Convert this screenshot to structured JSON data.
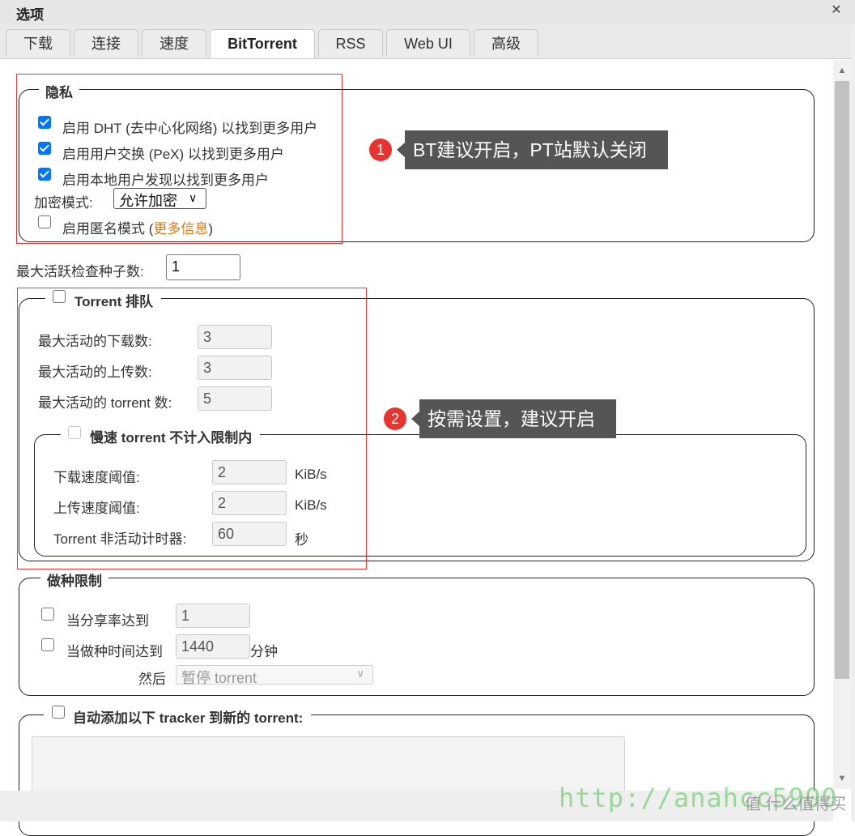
{
  "dialog": {
    "title": "选项",
    "close": "✕"
  },
  "tabs": [
    {
      "label": "下载"
    },
    {
      "label": "连接"
    },
    {
      "label": "速度"
    },
    {
      "label": "BitTorrent"
    },
    {
      "label": "RSS"
    },
    {
      "label": "Web UI"
    },
    {
      "label": "高级"
    }
  ],
  "privacy": {
    "legend": "隐私",
    "dht": "启用 DHT (去中心化网络) 以找到更多用户",
    "pex": "启用用户交换 (PeX) 以找到更多用户",
    "lsd": "启用本地用户发现以找到更多用户",
    "encryption_label": "加密模式:",
    "encryption_value": "允许加密",
    "anon_label": "启用匿名模式 (",
    "anon_link": "更多信息",
    "anon_close": ")"
  },
  "max_checking": {
    "label": "最大活跃检查种子数:",
    "value": "1"
  },
  "queue": {
    "legend": "Torrent 排队",
    "downloads_label": "最大活动的下载数:",
    "downloads_value": "3",
    "uploads_label": "最大活动的上传数:",
    "uploads_value": "3",
    "torrents_label": "最大活动的 torrent 数:",
    "torrents_value": "5",
    "slow": {
      "legend": "慢速 torrent 不计入限制内",
      "dl_label": "下载速度阈值:",
      "dl_value": "2",
      "dl_unit": "KiB/s",
      "ul_label": "上传速度阈值:",
      "ul_value": "2",
      "ul_unit": "KiB/s",
      "timer_label": "Torrent 非活动计时器:",
      "timer_value": "60",
      "timer_unit": "秒"
    }
  },
  "seeding": {
    "legend": "做种限制",
    "ratio_label": "当分享率达到",
    "ratio_value": "1",
    "time_label": "当做种时间达到",
    "time_value": "1440",
    "time_unit": "分钟",
    "then_label": "然后",
    "then_value": "暂停 torrent"
  },
  "trackers": {
    "legend": "自动添加以下 tracker 到新的 torrent:"
  },
  "annotations": {
    "note1_num": "1",
    "note1": "BT建议开启，PT站默认关闭",
    "note2_num": "2",
    "note2": "按需设置，建议开启"
  },
  "watermark": "http://anahcc5900",
  "brand": "值 什么值得买",
  "colors": {
    "accent": "#0075ff",
    "callout": "#555555",
    "annotation_red": "#e8332e",
    "link": "#e07a10"
  }
}
